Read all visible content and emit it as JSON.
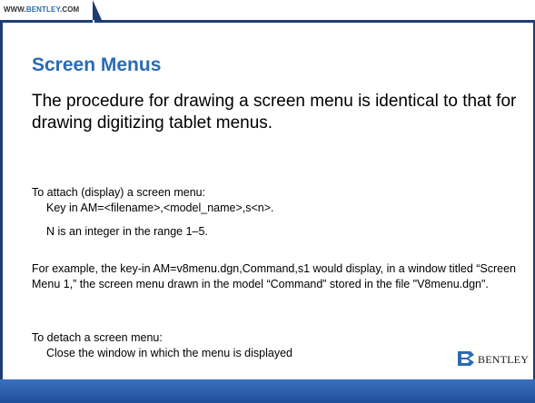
{
  "header": {
    "url_prefix": "WWW.",
    "url_brand": "BENTLEY",
    "url_suffix": ".COM"
  },
  "slide": {
    "title": "Screen Menus",
    "lead": "The procedure for drawing a screen menu is identical to that for drawing digitizing tablet menus.",
    "attach_heading": "To attach (display) a screen menu:",
    "attach_keyin": "Key in AM=<filename>,<model_name>,s<n>.",
    "attach_range": "N is an integer in the range 1–5.",
    "example": "For example, the key-in AM=v8menu.dgn,Command,s1 would display, in a window titled “Screen Menu 1,” the screen menu drawn in the model “Command” stored in the file \"V8menu.dgn\".",
    "detach_heading": "To detach a screen menu:",
    "detach_step": "Close the window in which the menu is displayed"
  },
  "logo": {
    "text": "BENTLEY",
    "icon": "bentley-b-logo-icon"
  },
  "colors": {
    "accent_blue": "#2a6ab3",
    "border_navy": "#1f3d72",
    "footer_blue": "#2f64b0"
  }
}
